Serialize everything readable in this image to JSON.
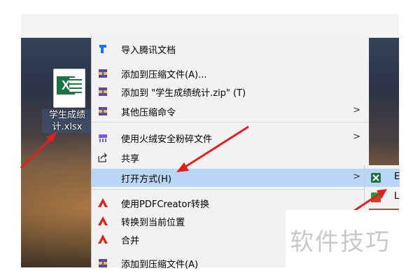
{
  "desktop": {
    "file_name": "学生成绩统计.xlsx",
    "file_name_line1": "学生成绩",
    "file_name_line2": "计.xlsx"
  },
  "menu": {
    "items": [
      {
        "label": "导入腾讯文档",
        "icon": "tencent-docs-icon"
      },
      {
        "label": "添加到压缩文件(A)...",
        "icon": "winrar-icon"
      },
      {
        "label": "添加到 \"学生成绩统计.zip\" (T)",
        "icon": "winrar-icon"
      },
      {
        "label": "其他压缩命令",
        "icon": "winrar-icon",
        "submenu": true
      },
      {
        "label": "使用火绒安全粉碎文件",
        "icon": "huorong-shredder-icon",
        "submenu": true
      },
      {
        "label": "共享",
        "icon": "share-icon"
      },
      {
        "label": "打开方式(H)",
        "icon": "",
        "submenu": true,
        "highlighted": true
      },
      {
        "label": "使用PDFCreator转换",
        "icon": "pdfcreator-icon"
      },
      {
        "label": "转换到当前位置",
        "icon": "pdfcreator-icon"
      },
      {
        "label": "合并",
        "icon": "pdfcreator-icon"
      },
      {
        "label": "添加到压缩文件(A)",
        "icon": "winrar-icon"
      }
    ],
    "submenu_arrow": ">"
  },
  "open_with_submenu": {
    "items": [
      {
        "label": "E",
        "icon": "excel-icon",
        "highlighted": true
      },
      {
        "label": "L",
        "icon": "app-icon"
      }
    ]
  },
  "watermark": {
    "text": "软件技巧"
  },
  "colors": {
    "highlight": "#b9d7f5",
    "menu_bg": "#f2f2f2",
    "arrow": "#e02020",
    "excel": "#1e7145"
  }
}
